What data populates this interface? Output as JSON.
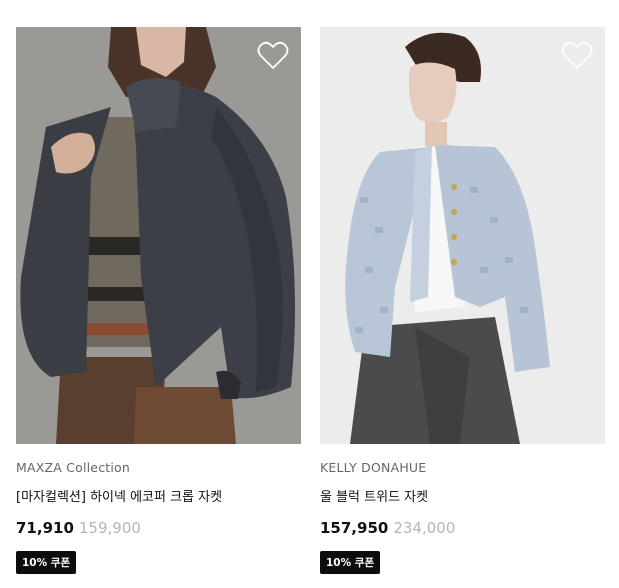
{
  "products": [
    {
      "brand": "MAXZA Collection",
      "title": "[마자컬렉션] 하이넥 에코퍼 크롭 자켓",
      "price": "71,910",
      "original_price": "159,900",
      "coupon": "10% 쿠폰",
      "wishlist_icon": "heart-icon"
    },
    {
      "brand": "KELLY DONAHUE",
      "title": "울 블럭 트위드 자켓",
      "price": "157,950",
      "original_price": "234,000",
      "coupon": "10% 쿠폰",
      "wishlist_icon": "heart-icon"
    }
  ]
}
